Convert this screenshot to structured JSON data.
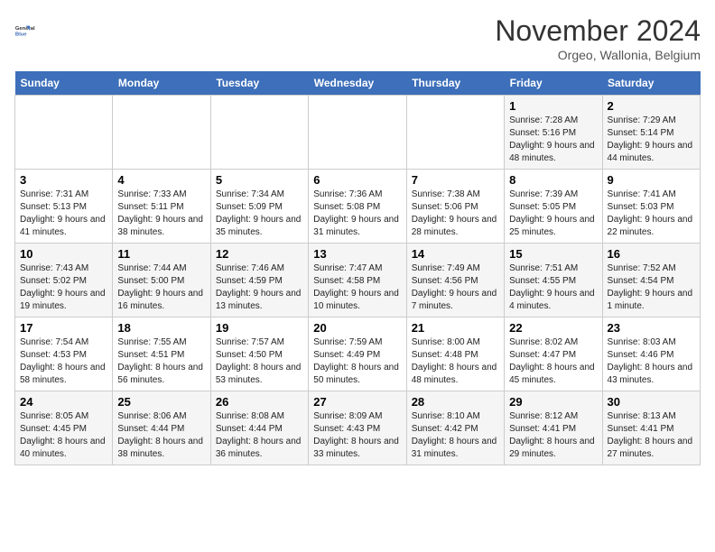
{
  "header": {
    "logo_line1": "General",
    "logo_line2": "Blue",
    "month_title": "November 2024",
    "subtitle": "Orgeo, Wallonia, Belgium"
  },
  "days_of_week": [
    "Sunday",
    "Monday",
    "Tuesday",
    "Wednesday",
    "Thursday",
    "Friday",
    "Saturday"
  ],
  "weeks": [
    [
      {
        "day": "",
        "info": ""
      },
      {
        "day": "",
        "info": ""
      },
      {
        "day": "",
        "info": ""
      },
      {
        "day": "",
        "info": ""
      },
      {
        "day": "",
        "info": ""
      },
      {
        "day": "1",
        "info": "Sunrise: 7:28 AM\nSunset: 5:16 PM\nDaylight: 9 hours and 48 minutes."
      },
      {
        "day": "2",
        "info": "Sunrise: 7:29 AM\nSunset: 5:14 PM\nDaylight: 9 hours and 44 minutes."
      }
    ],
    [
      {
        "day": "3",
        "info": "Sunrise: 7:31 AM\nSunset: 5:13 PM\nDaylight: 9 hours and 41 minutes."
      },
      {
        "day": "4",
        "info": "Sunrise: 7:33 AM\nSunset: 5:11 PM\nDaylight: 9 hours and 38 minutes."
      },
      {
        "day": "5",
        "info": "Sunrise: 7:34 AM\nSunset: 5:09 PM\nDaylight: 9 hours and 35 minutes."
      },
      {
        "day": "6",
        "info": "Sunrise: 7:36 AM\nSunset: 5:08 PM\nDaylight: 9 hours and 31 minutes."
      },
      {
        "day": "7",
        "info": "Sunrise: 7:38 AM\nSunset: 5:06 PM\nDaylight: 9 hours and 28 minutes."
      },
      {
        "day": "8",
        "info": "Sunrise: 7:39 AM\nSunset: 5:05 PM\nDaylight: 9 hours and 25 minutes."
      },
      {
        "day": "9",
        "info": "Sunrise: 7:41 AM\nSunset: 5:03 PM\nDaylight: 9 hours and 22 minutes."
      }
    ],
    [
      {
        "day": "10",
        "info": "Sunrise: 7:43 AM\nSunset: 5:02 PM\nDaylight: 9 hours and 19 minutes."
      },
      {
        "day": "11",
        "info": "Sunrise: 7:44 AM\nSunset: 5:00 PM\nDaylight: 9 hours and 16 minutes."
      },
      {
        "day": "12",
        "info": "Sunrise: 7:46 AM\nSunset: 4:59 PM\nDaylight: 9 hours and 13 minutes."
      },
      {
        "day": "13",
        "info": "Sunrise: 7:47 AM\nSunset: 4:58 PM\nDaylight: 9 hours and 10 minutes."
      },
      {
        "day": "14",
        "info": "Sunrise: 7:49 AM\nSunset: 4:56 PM\nDaylight: 9 hours and 7 minutes."
      },
      {
        "day": "15",
        "info": "Sunrise: 7:51 AM\nSunset: 4:55 PM\nDaylight: 9 hours and 4 minutes."
      },
      {
        "day": "16",
        "info": "Sunrise: 7:52 AM\nSunset: 4:54 PM\nDaylight: 9 hours and 1 minute."
      }
    ],
    [
      {
        "day": "17",
        "info": "Sunrise: 7:54 AM\nSunset: 4:53 PM\nDaylight: 8 hours and 58 minutes."
      },
      {
        "day": "18",
        "info": "Sunrise: 7:55 AM\nSunset: 4:51 PM\nDaylight: 8 hours and 56 minutes."
      },
      {
        "day": "19",
        "info": "Sunrise: 7:57 AM\nSunset: 4:50 PM\nDaylight: 8 hours and 53 minutes."
      },
      {
        "day": "20",
        "info": "Sunrise: 7:59 AM\nSunset: 4:49 PM\nDaylight: 8 hours and 50 minutes."
      },
      {
        "day": "21",
        "info": "Sunrise: 8:00 AM\nSunset: 4:48 PM\nDaylight: 8 hours and 48 minutes."
      },
      {
        "day": "22",
        "info": "Sunrise: 8:02 AM\nSunset: 4:47 PM\nDaylight: 8 hours and 45 minutes."
      },
      {
        "day": "23",
        "info": "Sunrise: 8:03 AM\nSunset: 4:46 PM\nDaylight: 8 hours and 43 minutes."
      }
    ],
    [
      {
        "day": "24",
        "info": "Sunrise: 8:05 AM\nSunset: 4:45 PM\nDaylight: 8 hours and 40 minutes."
      },
      {
        "day": "25",
        "info": "Sunrise: 8:06 AM\nSunset: 4:44 PM\nDaylight: 8 hours and 38 minutes."
      },
      {
        "day": "26",
        "info": "Sunrise: 8:08 AM\nSunset: 4:44 PM\nDaylight: 8 hours and 36 minutes."
      },
      {
        "day": "27",
        "info": "Sunrise: 8:09 AM\nSunset: 4:43 PM\nDaylight: 8 hours and 33 minutes."
      },
      {
        "day": "28",
        "info": "Sunrise: 8:10 AM\nSunset: 4:42 PM\nDaylight: 8 hours and 31 minutes."
      },
      {
        "day": "29",
        "info": "Sunrise: 8:12 AM\nSunset: 4:41 PM\nDaylight: 8 hours and 29 minutes."
      },
      {
        "day": "30",
        "info": "Sunrise: 8:13 AM\nSunset: 4:41 PM\nDaylight: 8 hours and 27 minutes."
      }
    ]
  ]
}
